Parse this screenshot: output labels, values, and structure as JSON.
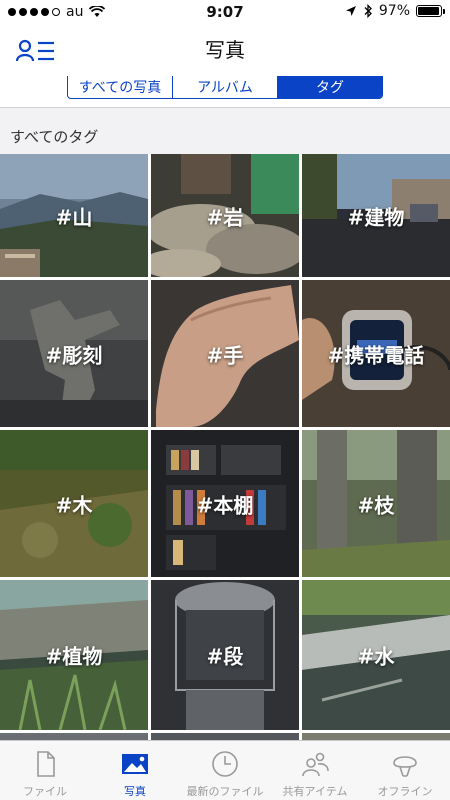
{
  "status_bar": {
    "carrier": "au",
    "time": "9:07",
    "battery": "97%",
    "battery_level": 0.97
  },
  "nav": {
    "title": "写真"
  },
  "segments": [
    {
      "label": "すべての写真",
      "active": false
    },
    {
      "label": "アルバム",
      "active": false
    },
    {
      "label": "タグ",
      "active": true
    }
  ],
  "section": {
    "header": "すべてのタグ"
  },
  "tags": [
    {
      "label": "#山"
    },
    {
      "label": "#岩"
    },
    {
      "label": "#建物"
    },
    {
      "label": "#彫刻"
    },
    {
      "label": "#手"
    },
    {
      "label": "#携帯電話"
    },
    {
      "label": "#木"
    },
    {
      "label": "#本棚"
    },
    {
      "label": "#枝"
    },
    {
      "label": "#植物"
    },
    {
      "label": "#段"
    },
    {
      "label": "#水"
    }
  ],
  "tabs": [
    {
      "label": "ファイル",
      "icon": "file-icon",
      "active": false
    },
    {
      "label": "写真",
      "icon": "photo-icon",
      "active": true
    },
    {
      "label": "最新のファイル",
      "icon": "clock-icon",
      "active": false
    },
    {
      "label": "共有アイテム",
      "icon": "people-icon",
      "active": false
    },
    {
      "label": "オフライン",
      "icon": "offline-icon",
      "active": false
    }
  ],
  "colors": {
    "accent": "#0b43c6",
    "tab_inactive": "#9a9a9a"
  }
}
